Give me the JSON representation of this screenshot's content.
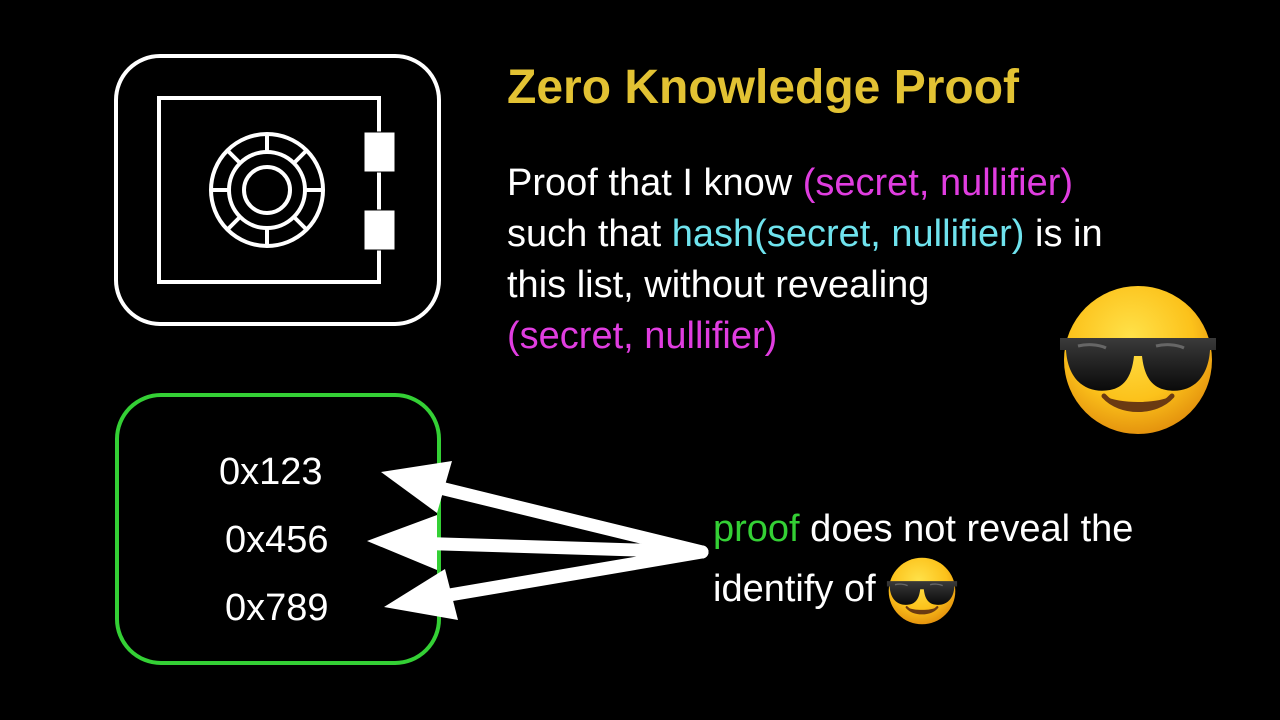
{
  "title": "Zero Knowledge Proof",
  "description": {
    "line1": {
      "prefix": "Proof that I know ",
      "highlight": "(secret, nullifier)"
    },
    "line2": {
      "prefix": "such that ",
      "highlight": "hash(secret, nullifier)",
      "suffix": " is in"
    },
    "line3": {
      "text": "this list, without revealing"
    },
    "line4": {
      "highlight": "(secret, nullifier)"
    }
  },
  "hash_list": {
    "items": [
      "0x123",
      "0x456",
      "0x789"
    ]
  },
  "caption": {
    "highlight": "proof",
    "line1_rest": " does not reveal the",
    "line2": "identify of "
  },
  "icons": {
    "safe": "safe-icon",
    "emoji": "sunglasses-face-emoji"
  },
  "colors": {
    "background": "#000000",
    "title": "#e2c233",
    "secret": "#e03de0",
    "hash": "#6fe3ee",
    "proof": "#34d035",
    "list_border": "#34d035"
  }
}
